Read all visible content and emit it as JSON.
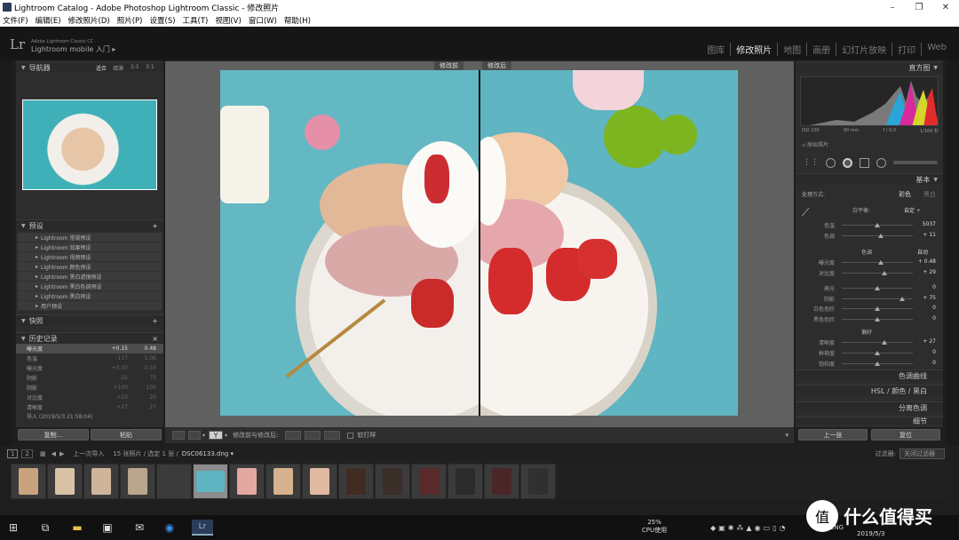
{
  "window": {
    "title": "Lightroom Catalog - Adobe Photoshop Lightroom Classic - 修改照片",
    "min": "–",
    "max": "❐",
    "close": "✕"
  },
  "menu": [
    "文件(F)",
    "编辑(E)",
    "修改照片(D)",
    "照片(P)",
    "设置(S)",
    "工具(T)",
    "视图(V)",
    "窗口(W)",
    "帮助(H)"
  ],
  "identity": {
    "logo": "Lr",
    "brand_line1": "Adobe Lightroom Classic CC",
    "brand_line2": "Lightroom mobile 入门 ▸"
  },
  "modules": [
    "图库",
    "修改照片",
    "地图",
    "画册",
    "幻灯片放映",
    "打印",
    "Web"
  ],
  "navigator": {
    "title": "导航器",
    "zoom": [
      "适合",
      "填满",
      "1:1",
      "3:1"
    ]
  },
  "presets": {
    "title": "预设",
    "items": [
      "Lightroom 常规预设",
      "Lightroom 效果预设",
      "Lightroom 视频预设",
      "Lightroom 颜色预设",
      "Lightroom 黑白滤镜预设",
      "Lightroom 黑白色调预设",
      "Lightroom 黑白预设",
      "用户预设"
    ]
  },
  "snapshots": {
    "title": "快照"
  },
  "history": {
    "title": "历史记录",
    "close": "×",
    "rows": [
      {
        "label": "曝光度",
        "a": "+0.15",
        "b": "0.48"
      },
      {
        "label": "色温",
        "a": "-117",
        "b": "5.0K"
      },
      {
        "label": "曝光度",
        "a": "+0.03",
        "b": "0.33"
      },
      {
        "label": "阴影",
        "a": "-25",
        "b": "75"
      },
      {
        "label": "阴影",
        "a": "+100",
        "b": "100"
      },
      {
        "label": "对比度",
        "a": "+29",
        "b": "29"
      },
      {
        "label": "清晰度",
        "a": "+27",
        "b": "27"
      },
      {
        "label": "导入 (2019/5/3 21:58:04)",
        "a": "",
        "b": ""
      }
    ]
  },
  "left_buttons": {
    "copy": "复制...",
    "paste": "粘贴"
  },
  "center": {
    "before": "修改前",
    "after": "修改后"
  },
  "toolbar": {
    "mode_label": "修改前与修改后:",
    "softproof": "软打样"
  },
  "histogram": {
    "title": "直方图",
    "iso": "ISO 100",
    "focal": "90 mm",
    "aperture": "f / 9.0",
    "shutter": "1/160 秒",
    "original": "原始照片"
  },
  "basic": {
    "title": "基本",
    "treatment": "处理方式:",
    "color": "彩色",
    "bw": "黑白",
    "wb_label": "白平衡:",
    "wb_value": "自定 ÷",
    "tone": "色调",
    "auto": "自动",
    "presence": "偏好",
    "sliders": [
      {
        "name": "色温",
        "value": "5037",
        "pos": 0.5
      },
      {
        "name": "色调",
        "value": "+ 11",
        "pos": 0.55
      },
      {
        "name": "曝光度",
        "value": "+ 0.48",
        "pos": 0.55
      },
      {
        "name": "对比度",
        "value": "+ 29",
        "pos": 0.6
      },
      {
        "name": "高光",
        "value": "0",
        "pos": 0.5
      },
      {
        "name": "阴影",
        "value": "+ 75",
        "pos": 0.85
      },
      {
        "name": "白色色阶",
        "value": "0",
        "pos": 0.5
      },
      {
        "name": "黑色色阶",
        "value": "0",
        "pos": 0.5
      },
      {
        "name": "清晰度",
        "value": "+ 27",
        "pos": 0.6
      },
      {
        "name": "鲜艳度",
        "value": "0",
        "pos": 0.5
      },
      {
        "name": "饱和度",
        "value": "0",
        "pos": 0.5
      }
    ]
  },
  "right_sections": [
    "色调曲线",
    "HSL / 颜色 / 黑白",
    "分离色调",
    "细节"
  ],
  "right_buttons": {
    "prev": "上一张",
    "reset": "复位"
  },
  "filmbar": {
    "source": "上一次导入",
    "count": "15 张照片 / 选定 1 张 /",
    "file": "DSC06133.dng ▾",
    "filter_label": "过滤器:",
    "filter_value": "关闭过滤器"
  },
  "taskbar": {
    "cpu_pct": "25%",
    "cpu_label": "CPU使用",
    "lang": "ENG",
    "date": "2019/5/3",
    "watermark": "什么值得买"
  },
  "colors": {
    "accent": "#e5e5e5",
    "panel": "#2d2d2d",
    "teal": "#5fb5c1"
  }
}
